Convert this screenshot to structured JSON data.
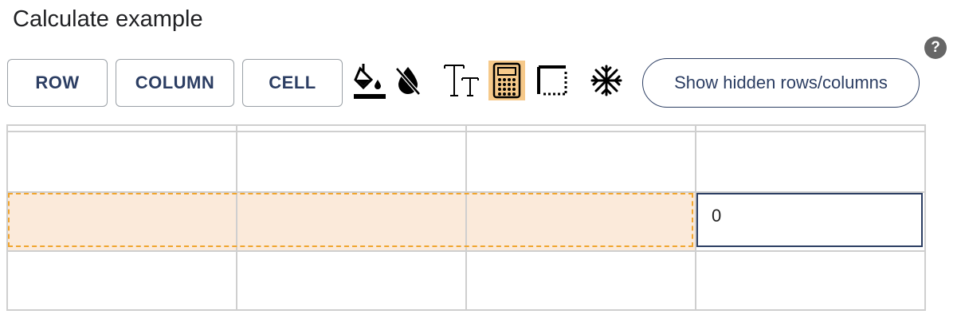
{
  "header": {
    "title": "Calculate example"
  },
  "help": {
    "icon": "help-circle-icon",
    "label": "?"
  },
  "toolbar": {
    "row_label": "ROW",
    "column_label": "COLUMN",
    "cell_label": "CELL",
    "icons": [
      "fill-color-icon",
      "no-fill-icon",
      "text-size-icon",
      "calculator-icon",
      "border-style-icon",
      "freeze-icon"
    ],
    "show_hidden_label": "Show hidden rows/columns"
  },
  "grid": {
    "rows": [
      [
        "",
        "",
        "",
        ""
      ],
      [
        "",
        "",
        "",
        ""
      ],
      [
        "",
        "",
        "",
        "0"
      ],
      [
        "",
        "",
        "",
        ""
      ]
    ],
    "selected_row": 2,
    "active_cell": {
      "row": 2,
      "col": 3,
      "value": "0"
    }
  },
  "colors": {
    "accent": "#2c3e63",
    "highlight": "#fbeada",
    "selection_dash": "#f0a52f",
    "active_tool": "#f6c98a"
  }
}
